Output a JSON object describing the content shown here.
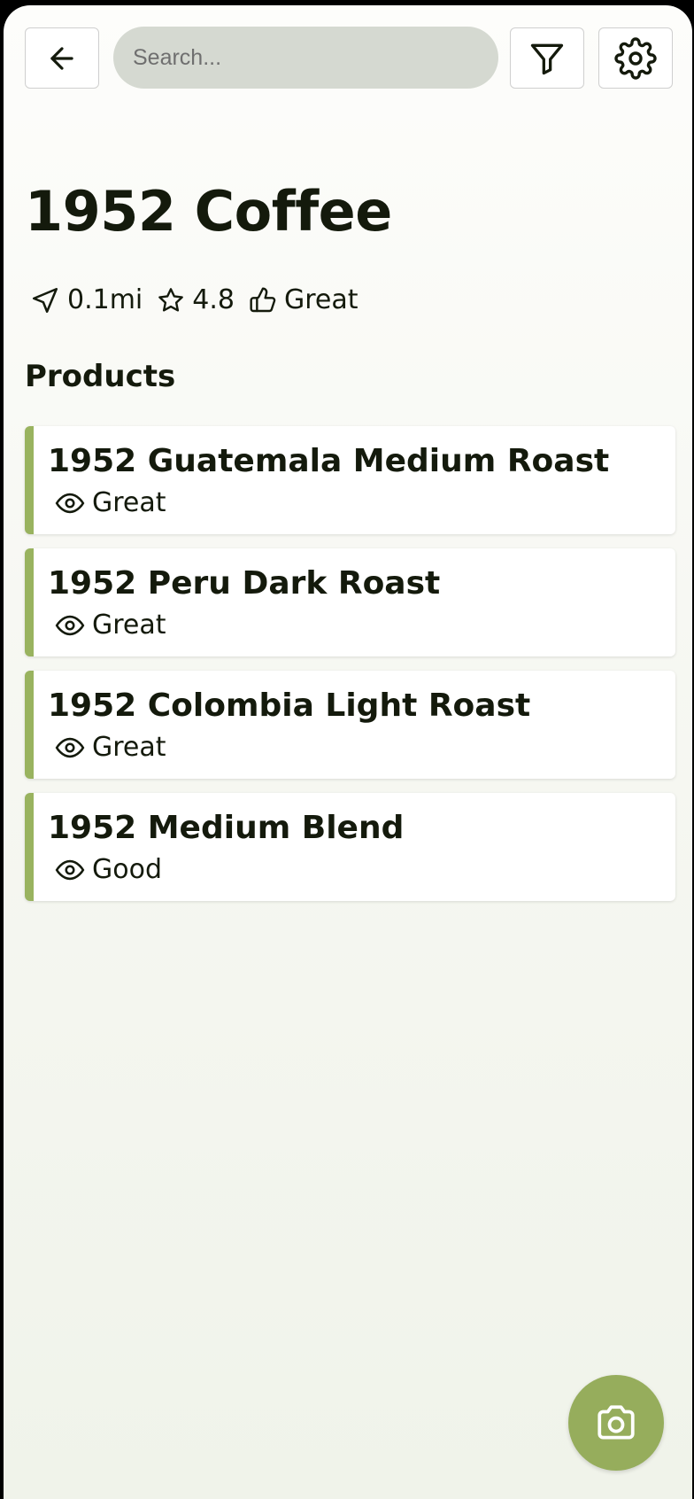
{
  "header": {
    "back_icon": "arrow-left-icon",
    "search_placeholder": "Search...",
    "search_value": "",
    "filter_icon": "filter-icon",
    "settings_icon": "gear-icon"
  },
  "place": {
    "name": "1952 Coffee",
    "distance": "0.1mi",
    "distance_icon": "navigation-arrow-icon",
    "rating": "4.8",
    "rating_icon": "star-icon",
    "verdict": "Great",
    "verdict_icon": "thumbs-up-icon"
  },
  "products_section": {
    "title": "Products",
    "accent_color": "#99b35f",
    "items": [
      {
        "name": "1952 Guatemala Medium Roast",
        "rating": "Great",
        "icon": "eye-icon"
      },
      {
        "name": "1952 Peru Dark Roast",
        "rating": "Great",
        "icon": "eye-icon"
      },
      {
        "name": "1952 Colombia Light Roast",
        "rating": "Great",
        "icon": "eye-icon"
      },
      {
        "name": "1952 Medium Blend",
        "rating": "Good",
        "icon": "eye-icon"
      }
    ]
  },
  "fab": {
    "icon": "camera-icon",
    "color": "#96ad5c"
  }
}
